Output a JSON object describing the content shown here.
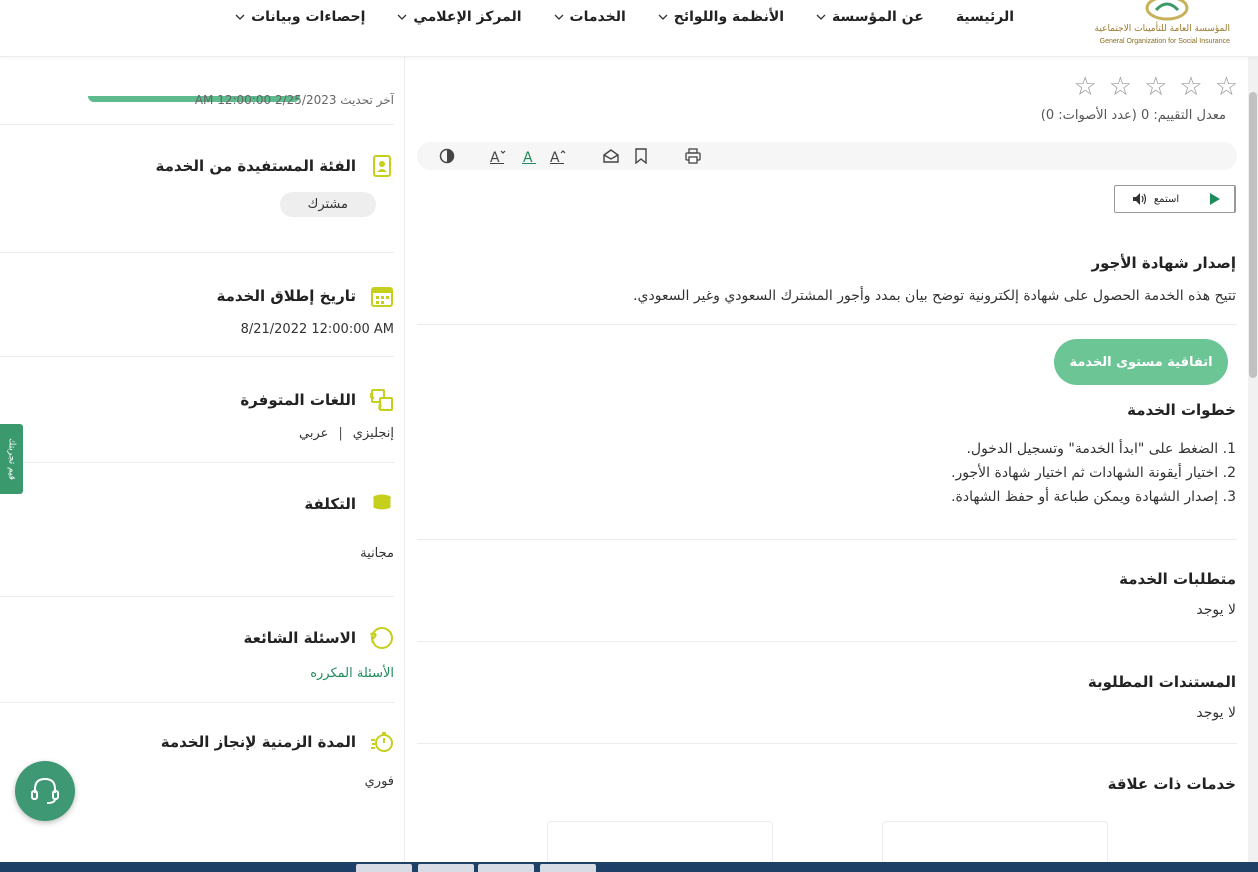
{
  "header": {
    "logo": {
      "arabic": "المؤسسة العامة للتأمينات الاجتماعية",
      "english": "General Organization for Social Insurance"
    },
    "nav": [
      {
        "label": "الرئيسية",
        "has_dropdown": false
      },
      {
        "label": "عن المؤسسة",
        "has_dropdown": true
      },
      {
        "label": "الأنظمة واللوائح",
        "has_dropdown": true
      },
      {
        "label": "الخدمات",
        "has_dropdown": true
      },
      {
        "label": "المركز الإعلامي",
        "has_dropdown": true
      },
      {
        "label": "إحصاءات وبيانات",
        "has_dropdown": true
      }
    ]
  },
  "sidebar": {
    "last_update": "آخر تحديث 2/25/2023 12:00:00 AM",
    "beneficiary": {
      "title": "الفئة المستفيدة من الخدمة",
      "value": "مشترك"
    },
    "launch_date": {
      "title": "تاريخ إطلاق الخدمة",
      "value": "8/21/2022 12:00:00 AM"
    },
    "languages": {
      "title": "اللغات المتوفرة",
      "values": [
        "إنجليزي",
        "عربي"
      ],
      "separator": "|"
    },
    "cost": {
      "title": "التكلفة",
      "value": "مجانية"
    },
    "faq": {
      "title": "الاسئلة الشائعة",
      "link": "الأسئلة المكرره"
    },
    "duration": {
      "title": "المدة الزمنية لإنجاز الخدمة",
      "value": "فوري"
    },
    "feedback_tab": "قيم تجربتك"
  },
  "main": {
    "rating": {
      "stars_total": 5,
      "stars_filled": 0,
      "text": "معدل التقييم: 0 (عدد الأصوات: 0)"
    },
    "listen": {
      "label": "استمع"
    },
    "service": {
      "title": "إصدار شهادة الأجور",
      "description": "تتيح هذه الخدمة الحصول على شهادة إلكترونية توضح بيان بمدد وأجور المشترك السعودي وغير السعودي."
    },
    "sla_button": "اتفاقية مستوى الخدمة",
    "steps": {
      "title": "خطوات الخدمة",
      "items": [
        "1. الضغط على \"ابدأ الخدمة\" وتسجيل الدخول.",
        "2. اختيار أيقونة الشهادات ثم اختيار شهادة الأجور.",
        "3. إصدار الشهادة ويمكن طباعة أو حفظ الشهادة."
      ]
    },
    "requirements": {
      "title": "متطلبات الخدمة",
      "value": "لا يوجد"
    },
    "documents": {
      "title": "المستندات المطلوبة",
      "value": "لا يوجد"
    },
    "related": {
      "title": "خدمات ذات علاقة"
    }
  },
  "colors": {
    "brand_green": "#3a9a6e",
    "accent_yellow": "#c6cf1c",
    "sla_green": "#6bc595"
  }
}
